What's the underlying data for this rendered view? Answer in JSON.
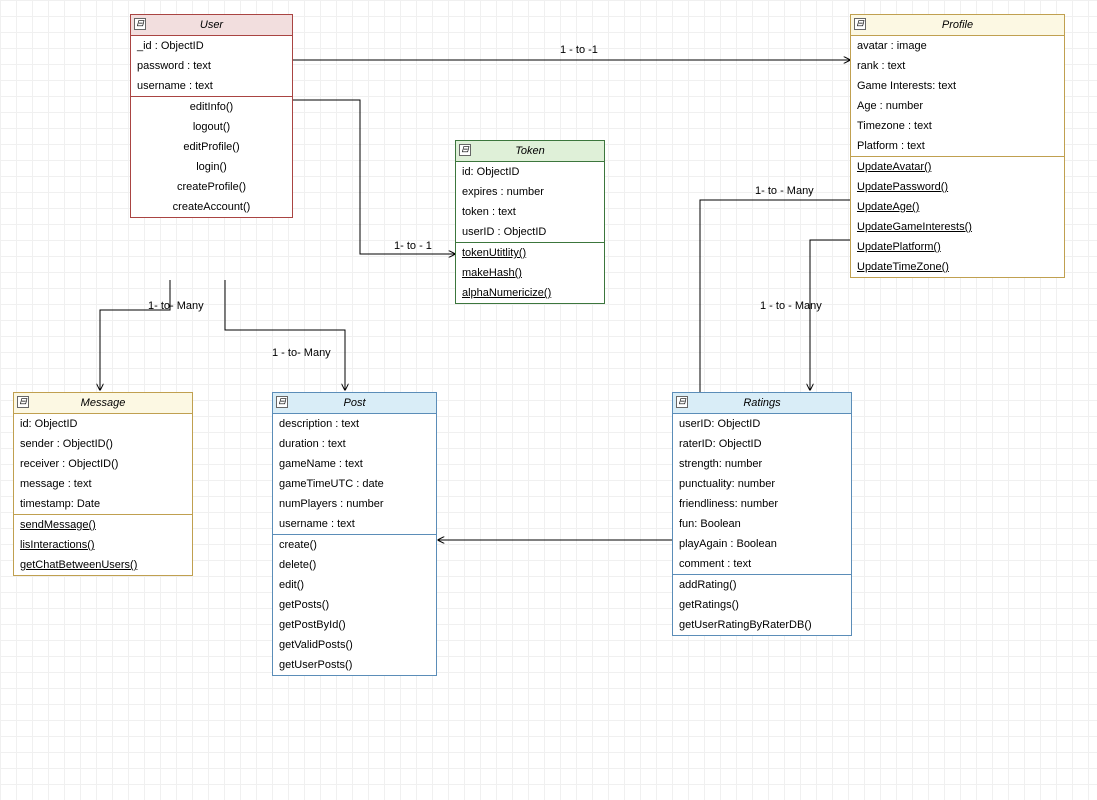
{
  "entities": {
    "user": {
      "title": "User",
      "attrs": [
        "_id : ObjectID",
        "password : text",
        "username : text"
      ],
      "methods": [
        "editInfo()",
        "logout()",
        "editProfile()",
        "login()",
        "createProfile()",
        "createAccount()"
      ]
    },
    "token": {
      "title": "Token",
      "attrs": [
        "id: ObjectID",
        "expires : number",
        "token : text",
        "userID : ObjectID"
      ],
      "methods": [
        "tokenUtitlity()",
        "makeHash()",
        "alphaNumericize()"
      ]
    },
    "profile": {
      "title": "Profile",
      "attrs": [
        "avatar : image",
        "rank : text",
        "Game Interests: text",
        "Age : number",
        "Timezone : text",
        "Platform : text"
      ],
      "methods": [
        "UpdateAvatar()",
        "UpdatePassword()",
        "UpdateAge()",
        "UpdateGameInterests()",
        "UpdatePlatform()",
        "UpdateTimeZone()"
      ]
    },
    "message": {
      "title": "Message",
      "attrs": [
        "id: ObjectID",
        "sender : ObjectID()",
        "receiver : ObjectID()",
        "message : text",
        "timestamp: Date"
      ],
      "methods": [
        "sendMessage()",
        "lisInteractions()",
        "getChatBetweenUsers()"
      ]
    },
    "post": {
      "title": "Post",
      "attrs": [
        "description : text",
        "duration : text",
        "gameName : text",
        "gameTimeUTC : date",
        "numPlayers : number",
        "username : text"
      ],
      "methods": [
        "create()",
        "delete()",
        "edit()",
        "getPosts()",
        "getPostById()",
        "getValidPosts()",
        "getUserPosts()"
      ]
    },
    "ratings": {
      "title": "Ratings",
      "attrs": [
        "userID: ObjectID",
        "raterID: ObjectID",
        "strength: number",
        "punctuality: number",
        "friendliness: number",
        "fun: Boolean",
        "playAgain : Boolean",
        "comment : text"
      ],
      "methods": [
        "addRating()",
        "getRatings()",
        "getUserRatingByRaterDB()"
      ]
    }
  },
  "labels": {
    "user_profile": "1 - to -1",
    "user_token": "1- to - 1",
    "user_message": "1- to- Many",
    "user_post": "1 - to- Many",
    "profile_ratings": "1 - to - Many",
    "profile_post": "1- to - Many"
  },
  "collapse_glyph": "⊟"
}
